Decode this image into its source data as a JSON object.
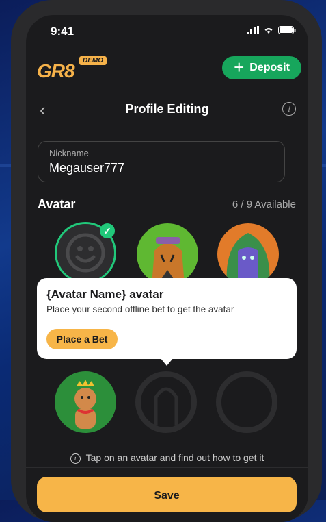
{
  "status_bar": {
    "time": "9:41"
  },
  "header": {
    "logo": "GR8",
    "demo_badge": "DEMO",
    "deposit_label": "Deposit"
  },
  "nav": {
    "title": "Profile Editing"
  },
  "nickname": {
    "label": "Nickname",
    "value": "Megauser777"
  },
  "avatars": {
    "title": "Avatar",
    "available": "6 / 9 Available",
    "items": [
      {
        "name": "smiley",
        "selected": true,
        "locked": false
      },
      {
        "name": "tiger",
        "selected": false,
        "locked": false
      },
      {
        "name": "green-hair-hero",
        "selected": false,
        "locked": false
      },
      {
        "name": "gingerbread-king",
        "selected": false,
        "locked": false
      },
      {
        "name": "locked-person",
        "selected": false,
        "locked": true
      },
      {
        "name": "locked-empty",
        "selected": false,
        "locked": true
      }
    ]
  },
  "tooltip": {
    "title": "{Avatar Name} avatar",
    "description": "Place your second offline bet to get the avatar",
    "button_label": "Place a Bet"
  },
  "hint": "Tap on an avatar and find out how to get it",
  "save_label": "Save",
  "colors": {
    "accent": "#f7b548",
    "deposit": "#17a65c",
    "selected": "#21c87a",
    "screen_bg": "#1b1b1d"
  }
}
